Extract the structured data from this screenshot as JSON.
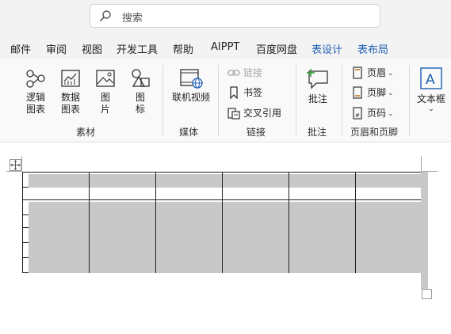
{
  "search": {
    "placeholder": "搜索"
  },
  "menu": {
    "tabs": [
      "邮件",
      "审阅",
      "视图",
      "开发工具",
      "帮助",
      "AIPPT",
      "百度网盘",
      "表设计",
      "表布局"
    ]
  },
  "ribbon": {
    "groups": {
      "sucai": {
        "label": "素材",
        "buttons": [
          {
            "line1": "逻辑",
            "line2": "图表"
          },
          {
            "line1": "数据",
            "line2": "图表"
          },
          {
            "line1": "图",
            "line2": "片"
          },
          {
            "line1": "图",
            "line2": "标"
          }
        ]
      },
      "meiti": {
        "label": "媒体",
        "button": "联机视频"
      },
      "lianjie": {
        "label": "链接",
        "items": [
          "链接",
          "书签",
          "交叉引用"
        ]
      },
      "pizhu": {
        "label": "批注",
        "button": "批注"
      },
      "yemei": {
        "label": "页眉和页脚",
        "items": [
          "页眉",
          "页脚",
          "页码"
        ]
      },
      "wenben": {
        "button": "文本框"
      }
    }
  },
  "table": {
    "rows": 7,
    "cols": 6
  },
  "colors": {
    "accent": "#1f5fb4",
    "selection": "#c8c8c8",
    "link_icon": "#a8a8a8"
  }
}
